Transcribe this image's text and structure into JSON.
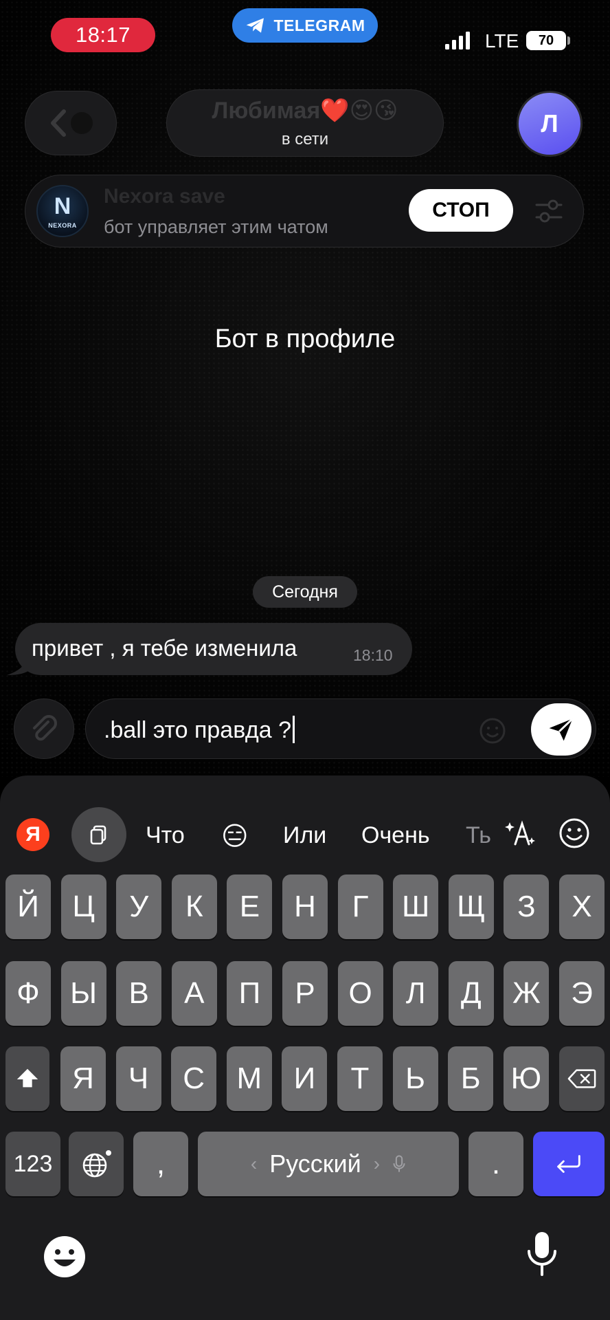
{
  "status_bar": {
    "time": "18:17",
    "app_pill": "TELEGRAM",
    "network": "LTE",
    "battery": "70"
  },
  "header": {
    "title": "Любимая❤️😍😘",
    "status": "в сети",
    "avatar_letter": "Л",
    "back_icon": "chevron-left-icon"
  },
  "bot_bar": {
    "name": "Nexora save",
    "description": "бот управляет этим чатом",
    "logo_letter": "N",
    "logo_word": "NEXORA",
    "stop_label": "СТОП"
  },
  "chat": {
    "empty_title": "Бот в профиле",
    "date_label": "Сегодня",
    "messages": [
      {
        "text": "привет , я тебе изменила",
        "time": "18:10",
        "direction": "incoming"
      }
    ]
  },
  "composer": {
    "value": ".ball это правда ?",
    "send_icon": "send-icon"
  },
  "keyboard": {
    "logo": "Я",
    "suggestions": [
      "Что",
      "😑",
      "Или",
      "Очень",
      "Ть"
    ],
    "row1": [
      "Й",
      "Ц",
      "У",
      "К",
      "Е",
      "Н",
      "Г",
      "Ш",
      "Щ",
      "З",
      "Х"
    ],
    "row2": [
      "Ф",
      "Ы",
      "В",
      "А",
      "П",
      "Р",
      "О",
      "Л",
      "Д",
      "Ж",
      "Э"
    ],
    "row3": [
      "Я",
      "Ч",
      "С",
      "М",
      "И",
      "Т",
      "Ь",
      "Б",
      "Ю"
    ],
    "numbers_label": "123",
    "comma": ",",
    "space_label": "Русский",
    "space_prev": "‹",
    "space_next": "›",
    "period": ".",
    "accent": "#4b4af7"
  }
}
